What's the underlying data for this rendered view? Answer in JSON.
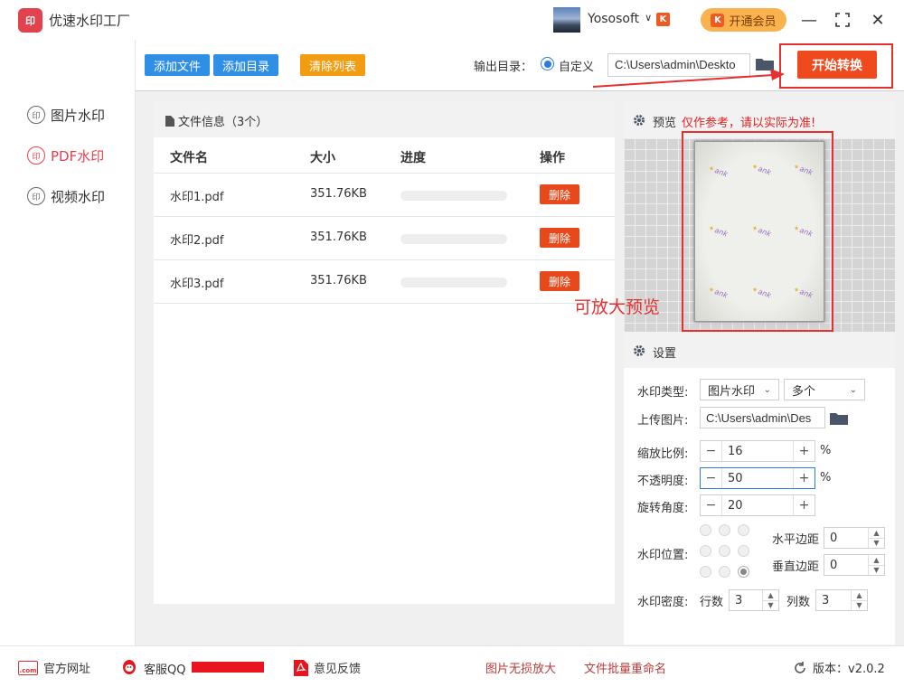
{
  "app": {
    "title": "优速水印工厂",
    "logo_text": "印",
    "user_name": "Yososoft",
    "user_dropdown": "∨",
    "user_logo": "K",
    "vip_label": "开通会员",
    "vip_icon": "K"
  },
  "window": {
    "minimize": "—",
    "maximize": "⛶",
    "close": "✕"
  },
  "sidebar": {
    "items": [
      {
        "label": "图片水印",
        "icon": "印",
        "active": false
      },
      {
        "label": "PDF水印",
        "icon": "印",
        "active": true
      },
      {
        "label": "视频水印",
        "icon": "印",
        "active": false
      }
    ]
  },
  "toolbar": {
    "add_file": "添加文件",
    "add_dir": "添加目录",
    "clear_list": "清除列表",
    "output_label": "输出目录：",
    "custom_label": "自定义",
    "output_path": "C:\\Users\\admin\\Deskto",
    "start_label": "开始转换"
  },
  "file_panel": {
    "header": "文件信息（3个）",
    "columns": [
      "文件名",
      "大小",
      "进度",
      "操作"
    ],
    "rows": [
      {
        "name": "水印1.pdf",
        "size": "351.76KB",
        "progress": 0,
        "action": "删除"
      },
      {
        "name": "水印2.pdf",
        "size": "351.76KB",
        "progress": 0,
        "action": "删除"
      },
      {
        "name": "水印3.pdf",
        "size": "351.76KB",
        "progress": 0,
        "action": "删除"
      }
    ]
  },
  "preview": {
    "title": "预览",
    "note": "仅作参考，请以实际为准!",
    "zoom_hint": "可放大预览",
    "watermark_text": "ank"
  },
  "settings": {
    "title": "设置",
    "type_label": "水印类型:",
    "type_value": "图片水印",
    "mode_value": "多个",
    "upload_label": "上传图片:",
    "upload_path": "C:\\Users\\admin\\Des",
    "scale_label": "缩放比例:",
    "scale_value": "16",
    "opacity_label": "不透明度:",
    "opacity_value": "50",
    "rotate_label": "旋转角度:",
    "rotate_value": "20",
    "percent": "%",
    "position_label": "水印位置:",
    "position_selected": 8,
    "h_margin_label": "水平边距",
    "h_margin_value": "0",
    "v_margin_label": "垂直边距",
    "v_margin_value": "0",
    "density_label": "水印密度:",
    "rows_label": "行数",
    "rows_value": "3",
    "cols_label": "列数",
    "cols_value": "3",
    "minus": "−",
    "plus": "+"
  },
  "footer": {
    "website": "官方网址",
    "website_icon": ".com",
    "qq": "客服QQ",
    "feedback": "意见反馈",
    "link_upscale": "图片无损放大",
    "link_rename": "文件批量重命名",
    "version": "版本：v2.0.2"
  },
  "colors": {
    "accent_red": "#e2424e",
    "start_orange": "#ee4a1e",
    "blue_button": "#2f8fe6",
    "orange_button": "#f39c12",
    "annotation_red": "#e53030"
  }
}
